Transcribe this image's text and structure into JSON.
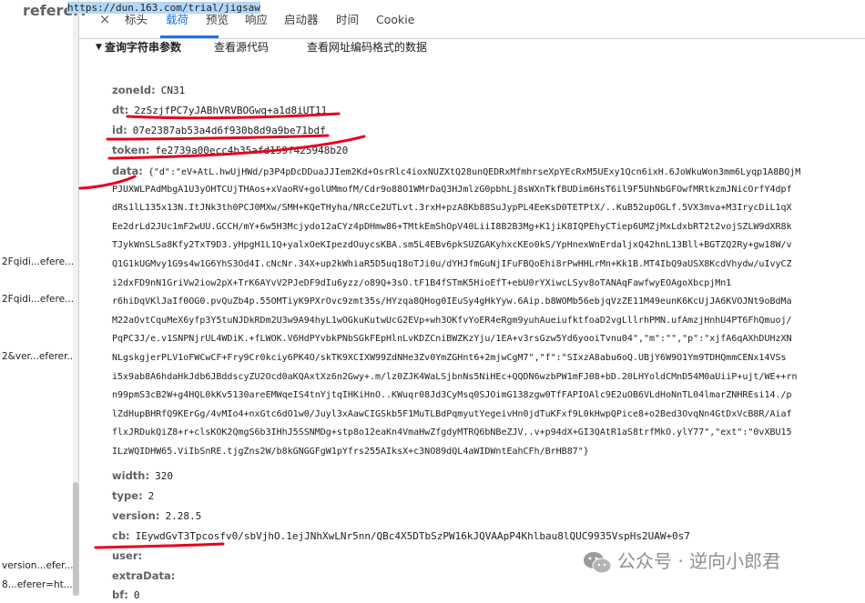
{
  "left_list": {
    "rows": [
      {
        "text": "2Fqidi...efere..."
      },
      {
        "text": "2Fqidi...efere..."
      },
      {
        "text": "2&ver...eferer..."
      },
      {
        "text": "version...efer..."
      },
      {
        "text": "8...eferer=ht..."
      }
    ]
  },
  "tabs": {
    "close_icon": "×",
    "items": [
      {
        "label": "标头",
        "active": false
      },
      {
        "label": "载荷",
        "active": true
      },
      {
        "label": "预览",
        "active": false
      },
      {
        "label": "响应",
        "active": false
      },
      {
        "label": "启动器",
        "active": false
      },
      {
        "label": "时间",
        "active": false
      },
      {
        "label": "Cookie",
        "active": false
      }
    ]
  },
  "section": {
    "title": "查询字符串参数",
    "view_source": "查看源代码",
    "view_url_encoded": "查看网址编码格式的数据"
  },
  "params": {
    "referer": {
      "key": "referer:",
      "value": "https://dun.163.com/trial/jigsaw"
    },
    "zoneId": {
      "key": "zoneId:",
      "value": "CN31"
    },
    "dt": {
      "key": "dt:",
      "value": "2zSzjfPC7yJABhVRVBOGwq+a1d8iUT11"
    },
    "id": {
      "key": "id:",
      "value": "07e2387ab53a4d6f930b8d9a9be71bdf"
    },
    "token": {
      "key": "token:",
      "value": "fe2739a00ecc4b35afd159f425948b20"
    },
    "data_key": "data:",
    "data_lines": [
      "{\"d\":\"eV+AtL.hwUjHWd/p3P4pDcDDuaJJIem2Kd+OsrRlc4ioxNUZXtQ28unQEDRxMfmhrseXpYEcRxM5UExy1Qcn6ixH.6JoWkuWon3mm6Lyqp1A8BQjM",
      "PJUXWLPAdMbgA1U3yOHTCUjTHAos+xVaoRV+golUMmofM/Cdr9o88O1WMrDaQ3HJmlzG0pbhLj8sWXnTkfBUDim6HsT6il9F5UhNbGFOwfMRtkzmJNicOrfY4dpf",
      "dRs1lL135x13N.ItJNk3th0PCJ0MXw/SMH+KQeTHyha/NRcCe2UTLvt.3rxH+pzA8Kb88SuJypPL4EeKsD0TETPtX/..KuB52upOGLf.5VX3mva+M3IrycDiL1qX",
      "Ee2drLd2JUc1mF2wUU.GCCH/mY+6w5H3Mcjydo12aCYz4pDHmw86+TMtkEmShOpV40LiiI8B2B3Mg+K1jiK8IQPEhyCTiep6UMZjMxLdxbRT2t2vojSZLW9dXR8k",
      "TJykWnSLSa8Kfy2TxT9D3.yHpgH1L1Q+yalxOeKIpezdOuycsKBA.sm5L4EBv6pkSUZGAKyhxcKEo0kS/YpHnexWnErdaljxQ42hnL13Bll+BGTZQ2Ry+gw18W/v",
      "Q1G1kUGMvy1G9s4w1G6YhS3Od4I.cNcNr.34X+up2kWhiaR5D5uq18oTJi0u/dYHJfmGuNjIFuFBQoEhi8rPwHHLrMn+Kk1B.MT4IbQ9aUSX8KcdVhydw/uIvyCZ",
      "i2dxFD9nN1GriVw2iow2pX+TrK6AYvV2PJeDF9dIu6yzz/o89Q+3sO.tF1B4fSTmK5HioEfT+ebU0rYXiwcLSyv8oTANAqFawfwyEOAgoXbcpjMn1",
      "r6hiDqVKlJaIf0OG0.pvQuZb4p.55OMTiyK9PXrOvc9zmt35s/HYzqa8QHog0IEuSy4gHkYyw.6Aip.b8WOMb56ebjqVzZE11M49eunK6KcUjJA6KVOJNt9oBdMa",
      "M22aOvtCquMeX6yfp3Y5tuNJDkRDm2U3w9A94hyL1wOGkuKutwUcG2EVp+wh3OKfvYoER4eRgm9yuhAueiufktfoaD2vgLllrhPMN.ufAmzjHnhU4PT6FhQmuoj/",
      "PqPC3J/e.v1SNPNjrUL4WDiK.+fLWOK.V6HdPYvbkPNbSGkFEpHlnLvKDZCniBWZKzYju/1EA+v3rsGzw5Yd6yooiTvnu04\",\"m\":\"\",\"p\":\"xjfA6qAXhDUHzXN",
      "NLgskgjerPLV1oFWCwCF+Fry9Cr0kciy6PK4O/skTK9XCIXW99ZdNHe3Zv0YmZGHnt6+2mjwCgM7\",\"f\":\"SIxzA8abu6oQ.UBjY6W9O1Ym9TDHQmmCENx14VSs",
      "i5x9ab8A6hdaHkJdb6JBddscyZU2Ocd0aKQAxtXz6n2Gwy+.m/lz0ZJK4WaLSjbnNs5NiHEc+QQDN6wzbPW1mFJ08+bD.20LHYoldCMnD54M0aUiiP+ujt/WE++rn",
      "n99pmS3cB2W+g4HQL0kKv5130areEMWqeIS4tnYjtqIHKiHnO..KWuqr08Jd3CyMsq0SJOimG138zgw0TfFAPIOAlc9E2uOB6VLdHoNnTL04lmarZNHREsi14./p",
      "lZdHupBHRfQ9KErGg/4vMIo4+nxGtc6dO1w0/Juyl3xAawCIGSkb5F1MuTLBdPqmyutYegeivHn0jdTuKFxf9L0kHwpQPice8+o2Bed3OvqNn4GtDxVcB8R/Aiaf",
      "flxJRDukQiZ8+r+clsKOK2QmgS6b3IHhJ5SSNMDg+stp8o12eaKn4VmaHwZfgdyMTRQ6bNBeZJV..v+p94dX+GI3QAtR1aS8trfMkO.ylY77\",\"ext\":\"0vXBU15",
      "ILzWQIDHW65.ViIbSnRE.tjgZns2W/b8kGNGGFgW1pYfrs255AIksX+c3NO89dQL4aWIDWntEahCFh/BrHB87\"}"
    ],
    "width": {
      "key": "width:",
      "value": "320"
    },
    "type": {
      "key": "type:",
      "value": "2"
    },
    "version": {
      "key": "version:",
      "value": "2.28.5"
    },
    "cb": {
      "key": "cb:",
      "value": "IEywdGvT3Tpcosfv0/sbVjhO.1ejJNhXwLNr5nn/QBc4X5DTbSzPW16kJQVAApP4Khlbau8lQUC9935VspHs2UAW+0s7"
    },
    "user": {
      "key": "user:",
      "value": ""
    },
    "extraData": {
      "key": "extraData:",
      "value": ""
    },
    "bf": {
      "key": "bf:",
      "value": "0"
    }
  },
  "watermark": {
    "text": "公众号 · 逆向小郎君"
  },
  "colors": {
    "accent": "#1a73e8",
    "annotation": "#e8001c",
    "highlight": "#cfe8fc"
  }
}
